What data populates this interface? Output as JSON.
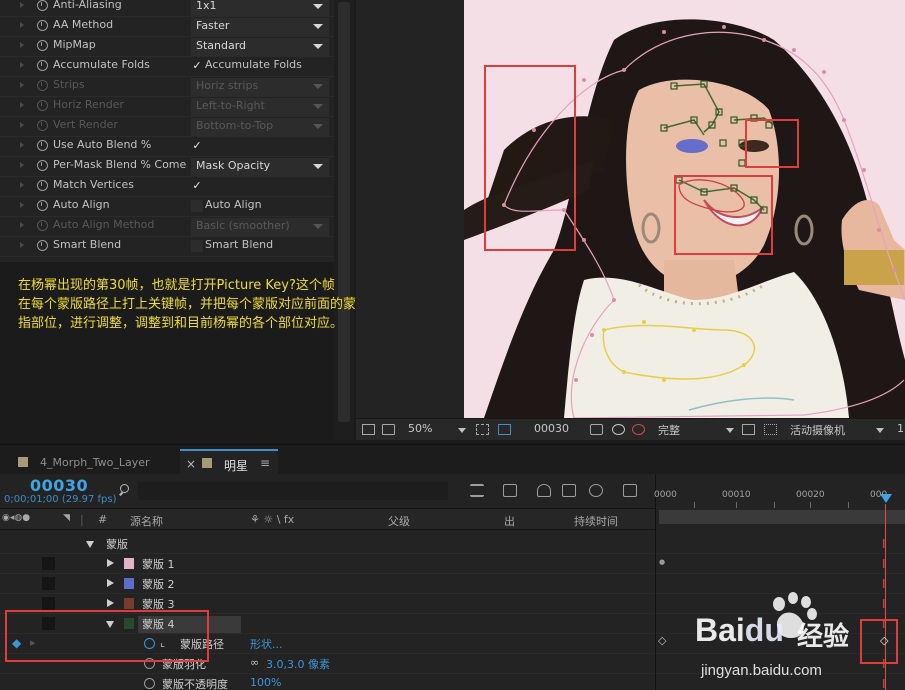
{
  "effect_controls": {
    "rows": [
      {
        "name": "Anti-Aliasing",
        "kind": "select",
        "value": "1x1",
        "disabled": false
      },
      {
        "name": "AA Method",
        "kind": "select",
        "value": "Faster",
        "disabled": false
      },
      {
        "name": "MipMap",
        "kind": "select",
        "value": "Standard",
        "disabled": false
      },
      {
        "name": "Accumulate Folds",
        "kind": "check",
        "checked": true,
        "label": "Accumulate Folds",
        "disabled": false
      },
      {
        "name": "Strips",
        "kind": "select",
        "value": "Horiz strips",
        "disabled": true
      },
      {
        "name": "Horiz Render",
        "kind": "select",
        "value": "Left-to-Right",
        "disabled": true
      },
      {
        "name": "Vert Render",
        "kind": "select",
        "value": "Bottom-to-Top",
        "disabled": true
      },
      {
        "name": "Use Auto Blend %",
        "kind": "check",
        "checked": true,
        "label": "",
        "disabled": false
      },
      {
        "name": "Per-Mask Blend % Come",
        "kind": "select",
        "value": "Mask Opacity",
        "disabled": false
      },
      {
        "name": "Match Vertices",
        "kind": "check",
        "checked": true,
        "label": "",
        "disabled": false
      },
      {
        "name": "Auto Align",
        "kind": "check",
        "checked": false,
        "label": "Auto Align",
        "disabled": false
      },
      {
        "name": "Auto Align Method",
        "kind": "select",
        "value": "Basic (smoother)",
        "disabled": true
      },
      {
        "name": "Smart Blend",
        "kind": "check",
        "checked": false,
        "label": "Smart Blend",
        "disabled": false
      }
    ],
    "check_glyph": "✓"
  },
  "instructions": {
    "line1": "在杨幂出现的第30帧，也就是打开Picture Key?这个帧",
    "line2": "在每个蒙版路径上打上关键帧，并把每个蒙版对应前面的蒙版所",
    "line3": "指部位，进行调整，调整到和目前杨幂的各个部位对应。",
    "color": "#f2df2a"
  },
  "viewer_toolbar": {
    "zoom": "50%",
    "frame": "00030",
    "resolution": "完整",
    "camera": "活动摄像机",
    "views": "1"
  },
  "tabs": {
    "inactive": "4_Morph_Two_Layer",
    "active": "明星",
    "close": "×",
    "menu": "≡"
  },
  "timeline": {
    "timecode": "00030",
    "fps": "0;00;01;00 (29.97 fps)",
    "search_prefix": "ρ▾",
    "columns": {
      "hash": "#",
      "source": "源名称",
      "switches": "⚘ ☼ \\ fx",
      "parent": "父级",
      "out": "出",
      "duration": "持续时间"
    },
    "mask_group": "蒙版",
    "masks": [
      {
        "name": "蒙版 1",
        "color": "#e3b3c7"
      },
      {
        "name": "蒙版 2",
        "color": "#5d6ec9"
      },
      {
        "name": "蒙版 3",
        "color": "#7a3b2d"
      },
      {
        "name": "蒙版 4",
        "color": "#264b2a"
      }
    ],
    "props": [
      {
        "name": "蒙版路径",
        "value": "形状..."
      },
      {
        "name": "蒙版羽化",
        "value": "3.0,3.0 像素"
      },
      {
        "name": "蒙版不透明度",
        "value": "100%"
      }
    ],
    "ruler": [
      "0000",
      "00010",
      "00020",
      "000"
    ],
    "keyframe_glyph": "◆"
  },
  "watermark": {
    "brand": "Bai",
    "brand2": "du",
    "cn": "经验",
    "url": "jingyan.baidu.com"
  },
  "colors": {
    "accent": "#3ea5e0",
    "playhead": "#e04b4b",
    "annotation": "#e03c3c"
  }
}
